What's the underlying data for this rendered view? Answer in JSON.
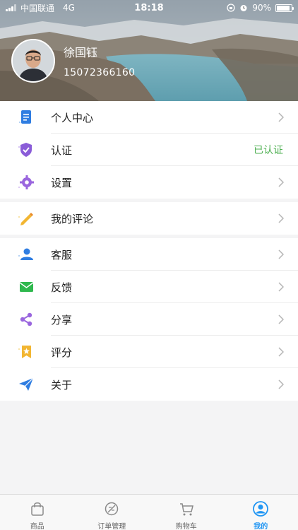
{
  "status_bar": {
    "carrier": "中国联通",
    "network": "4G",
    "time": "18:18",
    "battery": "90%"
  },
  "profile": {
    "name": "徐国钰",
    "phone": "15072366160"
  },
  "menu": {
    "personal_center": "个人中心",
    "verification": "认证",
    "verification_status": "已认证",
    "settings": "设置",
    "my_reviews": "我的评论",
    "customer_service": "客服",
    "feedback": "反馈",
    "share": "分享",
    "rating": "评分",
    "about": "关于"
  },
  "icons": {
    "personal_center": "document-icon",
    "verification": "shield-icon",
    "settings": "gear-icon",
    "my_reviews": "pencil-icon",
    "customer_service": "user-icon",
    "feedback": "mail-icon",
    "share": "share-icon",
    "rating": "star-badge-icon",
    "about": "paper-plane-icon"
  },
  "tabs": [
    {
      "label": "商品",
      "icon": "bag-icon"
    },
    {
      "label": "订单管理",
      "icon": "order-icon"
    },
    {
      "label": "购物车",
      "icon": "cart-icon"
    },
    {
      "label": "我的",
      "icon": "profile-icon"
    }
  ],
  "colors": {
    "accent": "#2196f3",
    "verified": "#4caf50",
    "background": "#f4f4f5"
  }
}
